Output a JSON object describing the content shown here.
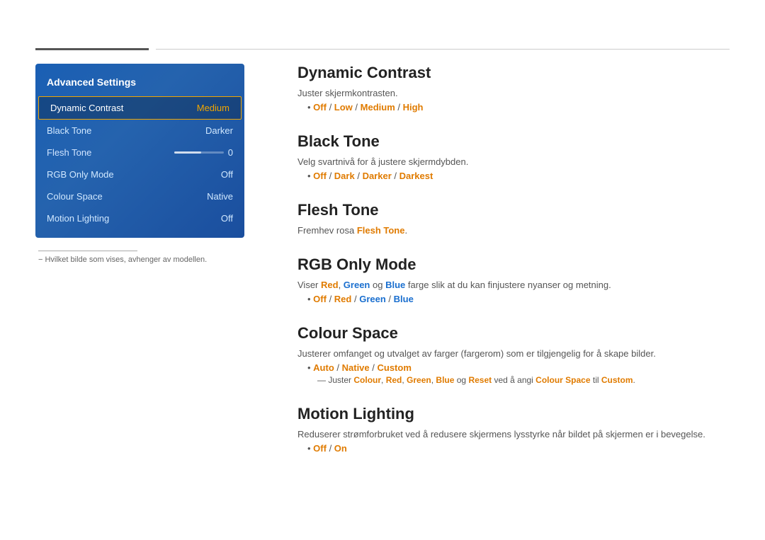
{
  "topLines": {},
  "leftPanel": {
    "menuTitle": "Advanced Settings",
    "menuItems": [
      {
        "label": "Dynamic Contrast",
        "value": "Medium",
        "active": true
      },
      {
        "label": "Black Tone",
        "value": "Darker",
        "active": false
      },
      {
        "label": "Flesh Tone",
        "value": "0",
        "active": false,
        "hasSlider": true
      },
      {
        "label": "RGB Only Mode",
        "value": "Off",
        "active": false
      },
      {
        "label": "Colour Space",
        "value": "Native",
        "active": false
      },
      {
        "label": "Motion Lighting",
        "value": "Off",
        "active": false
      }
    ],
    "footnote": "− Hvilket bilde som vises, avhenger av modellen."
  },
  "sections": [
    {
      "id": "dynamic-contrast",
      "title": "Dynamic Contrast",
      "desc": "Juster skjermkontrasten.",
      "options": "Off / Low / Medium / High",
      "optionsHighlight": [
        {
          "text": "Off",
          "style": "orange"
        },
        {
          "text": " / ",
          "style": "plain"
        },
        {
          "text": "Low",
          "style": "orange"
        },
        {
          "text": " / ",
          "style": "plain"
        },
        {
          "text": "Medium",
          "style": "orange"
        },
        {
          "text": " / ",
          "style": "plain"
        },
        {
          "text": "High",
          "style": "orange"
        }
      ]
    },
    {
      "id": "black-tone",
      "title": "Black Tone",
      "desc": "Velg svartnivå for å justere skjermdybden.",
      "options": "Off / Dark / Darker / Darkest",
      "optionsHighlight": [
        {
          "text": "Off",
          "style": "orange"
        },
        {
          "text": " / ",
          "style": "plain"
        },
        {
          "text": "Dark",
          "style": "orange"
        },
        {
          "text": " / ",
          "style": "plain"
        },
        {
          "text": "Darker",
          "style": "orange"
        },
        {
          "text": " / ",
          "style": "plain"
        },
        {
          "text": "Darkest",
          "style": "orange"
        }
      ]
    },
    {
      "id": "flesh-tone",
      "title": "Flesh Tone",
      "desc": "Fremhev rosa",
      "descHighlight": "Flesh Tone",
      "descEnd": "."
    },
    {
      "id": "rgb-only-mode",
      "title": "RGB Only Mode",
      "desc": "Viser",
      "descParts": [
        {
          "text": "Viser ",
          "style": "plain"
        },
        {
          "text": "Red",
          "style": "orange"
        },
        {
          "text": ", ",
          "style": "plain"
        },
        {
          "text": "Green",
          "style": "blue"
        },
        {
          "text": " og ",
          "style": "plain"
        },
        {
          "text": "Blue",
          "style": "blue"
        },
        {
          "text": " farge slik at du kan finjustere nyanser og metning.",
          "style": "plain"
        }
      ],
      "options": "Off / Red / Green / Blue",
      "optionsHighlight": [
        {
          "text": "Off",
          "style": "orange"
        },
        {
          "text": " / ",
          "style": "plain"
        },
        {
          "text": "Red",
          "style": "orange"
        },
        {
          "text": " / ",
          "style": "plain"
        },
        {
          "text": "Green",
          "style": "blue"
        },
        {
          "text": " / ",
          "style": "plain"
        },
        {
          "text": "Blue",
          "style": "blue"
        }
      ]
    },
    {
      "id": "colour-space",
      "title": "Colour Space",
      "desc": "Justerer omfanget og utvalget av farger (fargerom) som er tilgjengelig for å skape bilder.",
      "options": "Auto / Native / Custom",
      "optionsHighlight": [
        {
          "text": "Auto",
          "style": "orange"
        },
        {
          "text": " / ",
          "style": "plain"
        },
        {
          "text": "Native",
          "style": "orange"
        },
        {
          "text": " / ",
          "style": "plain"
        },
        {
          "text": "Custom",
          "style": "orange"
        }
      ],
      "subNote": "Juster Colour, Red, Green, Blue og Reset ved å angi Colour Space til Custom.",
      "subNoteParts": [
        {
          "text": "Juster ",
          "style": "plain"
        },
        {
          "text": "Colour",
          "style": "orange"
        },
        {
          "text": ", ",
          "style": "plain"
        },
        {
          "text": "Red",
          "style": "orange"
        },
        {
          "text": ", ",
          "style": "plain"
        },
        {
          "text": "Green",
          "style": "orange"
        },
        {
          "text": ", ",
          "style": "plain"
        },
        {
          "text": "Blue",
          "style": "orange"
        },
        {
          "text": " og ",
          "style": "plain"
        },
        {
          "text": "Reset",
          "style": "orange"
        },
        {
          "text": " ved å angi ",
          "style": "plain"
        },
        {
          "text": "Colour Space",
          "style": "orange"
        },
        {
          "text": " til ",
          "style": "plain"
        },
        {
          "text": "Custom",
          "style": "orange"
        },
        {
          "text": ".",
          "style": "plain"
        }
      ]
    },
    {
      "id": "motion-lighting",
      "title": "Motion Lighting",
      "desc": "Reduserer strømforbruket ved å redusere skjermens lysstyrke når bildet på skjermen er i bevegelse.",
      "options": "Off / On",
      "optionsHighlight": [
        {
          "text": "Off",
          "style": "orange"
        },
        {
          "text": " / ",
          "style": "plain"
        },
        {
          "text": "On",
          "style": "orange"
        }
      ]
    }
  ]
}
